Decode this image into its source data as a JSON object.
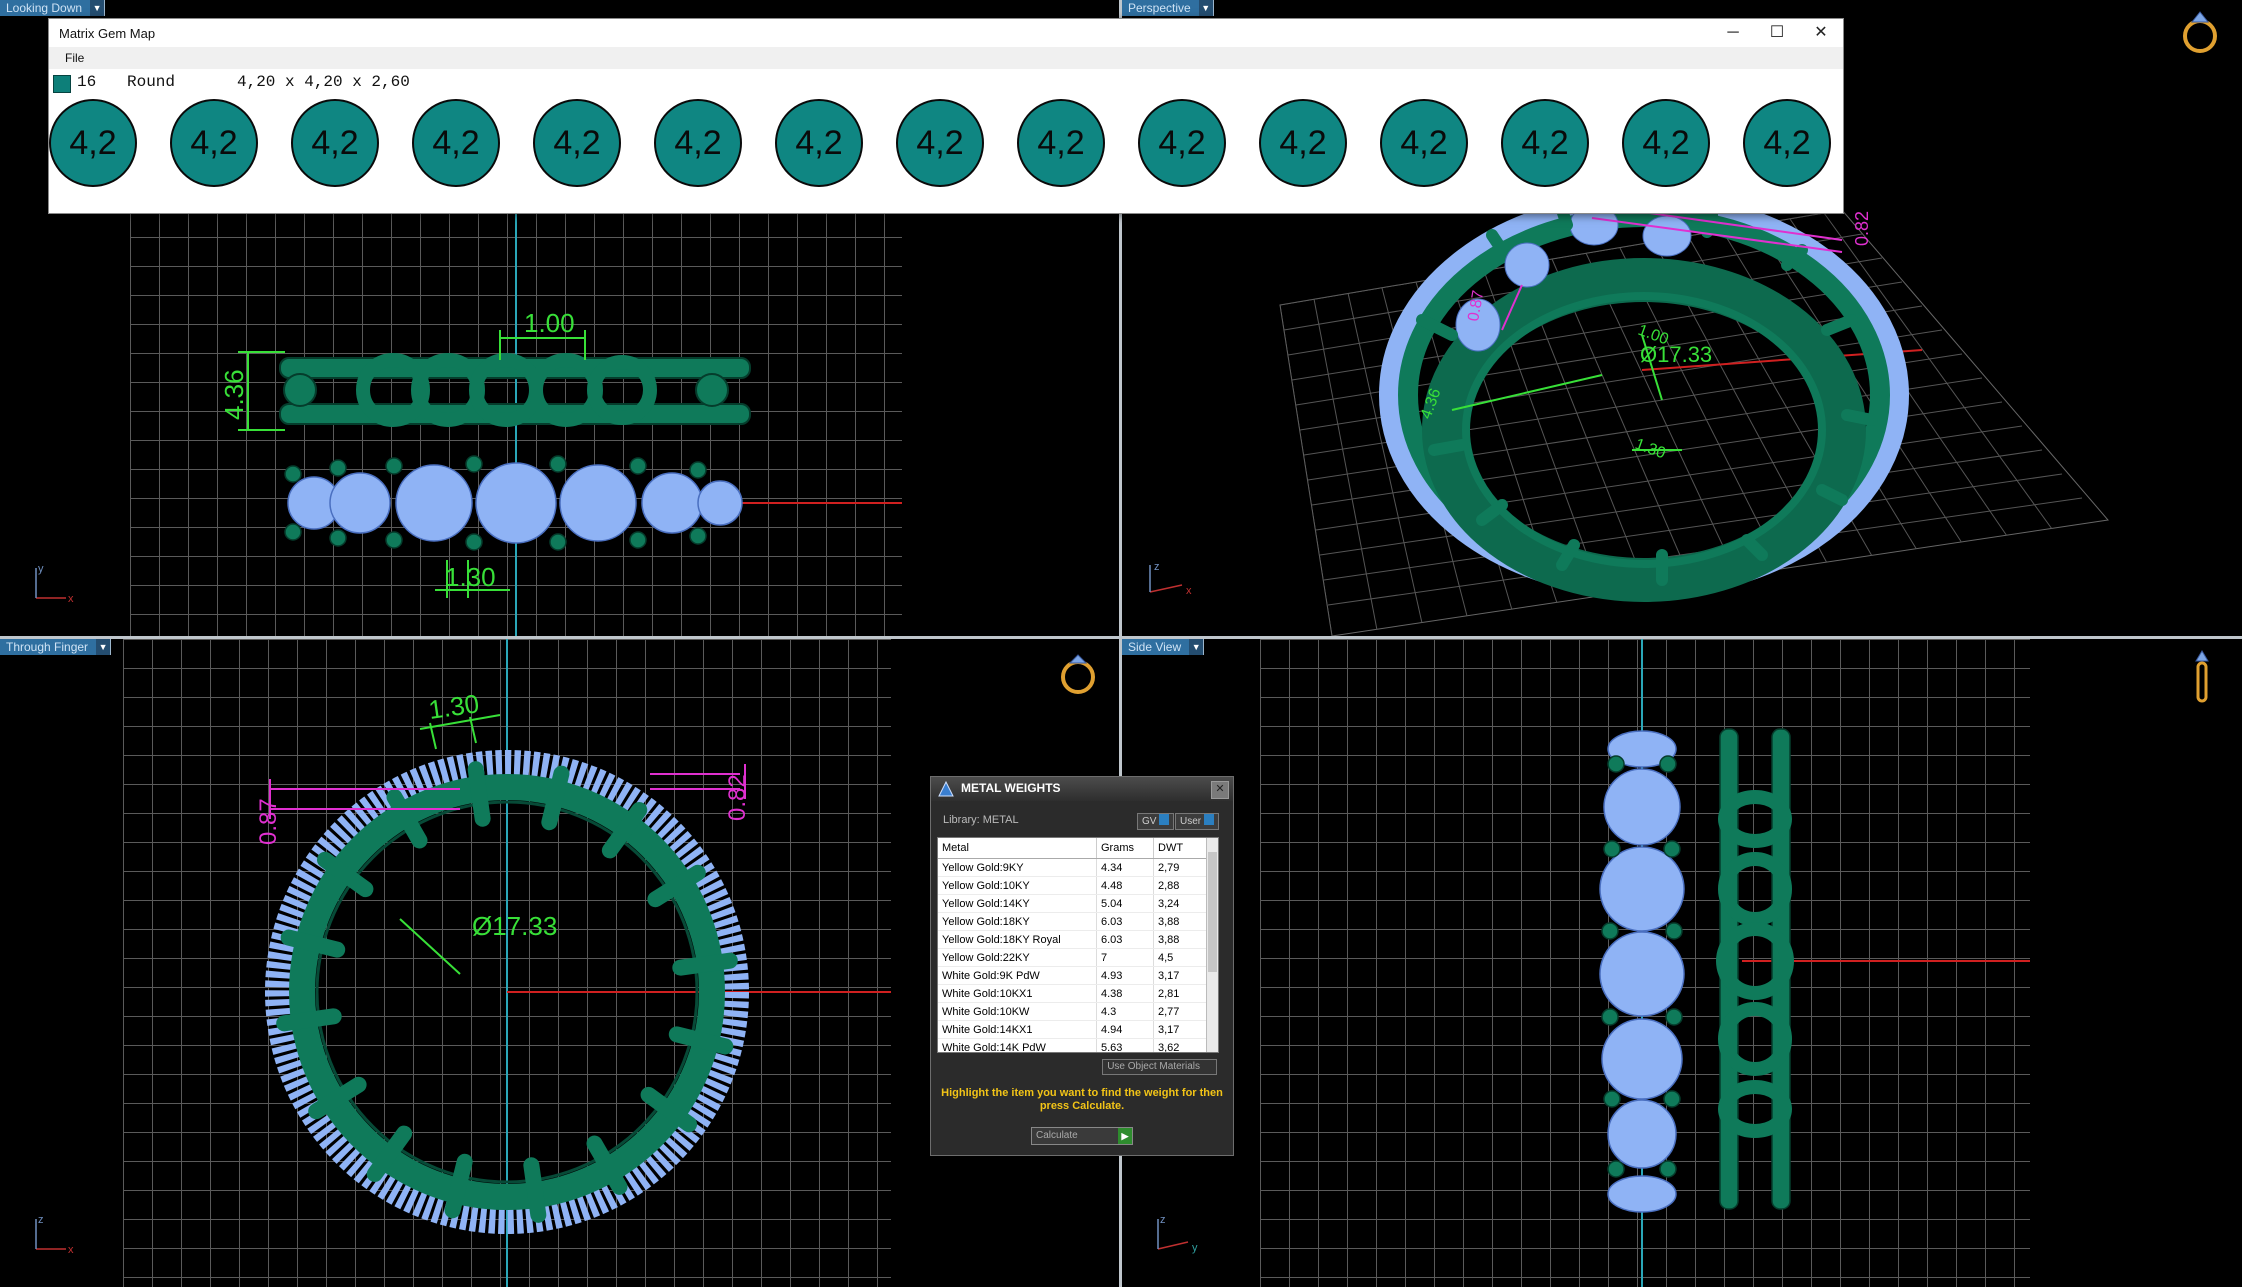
{
  "viewports": {
    "top_left": {
      "label": "Looking Down"
    },
    "top_right": {
      "label": "Perspective"
    },
    "bottom_left": {
      "label": "Through Finger"
    },
    "bottom_right": {
      "label": "Side View"
    }
  },
  "dimensions": {
    "top_left": {
      "width_top": "1.00",
      "height_left": "4.36",
      "gap_bottom": "1.30"
    },
    "top_right": {
      "diameter": "Ø17.33",
      "small_a": "1.00",
      "small_b": "1.30",
      "side_a": "4.36",
      "side_b": "0.87",
      "top_right_val": "0.82"
    },
    "bottom_left": {
      "top": "1.30",
      "left": "0.87",
      "right": "0.82",
      "diameter": "Ø17.33"
    }
  },
  "axes": {
    "top_left": {
      "v": "y",
      "h": "x"
    },
    "top_right": {
      "v": "z",
      "h": "x"
    },
    "bottom_left": {
      "v": "z",
      "h": "x"
    },
    "bottom_right": {
      "v": "z",
      "h": "y"
    }
  },
  "gem_window": {
    "title": "Matrix Gem Map",
    "menu": "File",
    "count": "16",
    "shape": "Round",
    "size": "4,20 x 4,20 x 2,60",
    "swatch_color": "#0d7f79",
    "gem_labels": [
      "4,2",
      "4,2",
      "4,2",
      "4,2",
      "4,2",
      "4,2",
      "4,2",
      "4,2",
      "4,2",
      "4,2",
      "4,2",
      "4,2",
      "4,2",
      "4,2",
      "4,2"
    ],
    "controls": {
      "minimize": "─",
      "maximize": "☐",
      "close": "✕"
    }
  },
  "metal_weights": {
    "title": "METAL WEIGHTS",
    "library": "Library: METAL",
    "btn_gv": "GV",
    "btn_user": "User",
    "columns": [
      "Metal",
      "Grams",
      "DWT"
    ],
    "rows": [
      [
        "Yellow Gold:9KY",
        "4.34",
        "2,79"
      ],
      [
        "Yellow Gold:10KY",
        "4.48",
        "2,88"
      ],
      [
        "Yellow Gold:14KY",
        "5.04",
        "3,24"
      ],
      [
        "Yellow Gold:18KY",
        "6.03",
        "3,88"
      ],
      [
        "Yellow Gold:18KY Royal",
        "6.03",
        "3,88"
      ],
      [
        "Yellow Gold:22KY",
        "7",
        "4,5"
      ],
      [
        "White Gold:9K PdW",
        "4.93",
        "3,17"
      ],
      [
        "White Gold:10KX1",
        "4.38",
        "2,81"
      ],
      [
        "White Gold:10KW",
        "4.3",
        "2,77"
      ],
      [
        "White Gold:14KX1",
        "4.94",
        "3,17"
      ],
      [
        "White Gold:14K PdW",
        "5.63",
        "3,62"
      ]
    ],
    "use_object_materials": "Use Object Materials",
    "message": "Highlight the item you want to find the weight for then press Calculate.",
    "calculate": "Calculate",
    "close": "✕"
  },
  "colors": {
    "metal": "#0f7a5a",
    "gem": "#8fb3f5",
    "dimension_green": "#38e038",
    "dimension_magenta": "#e030d0",
    "grid": "#5a5a5a"
  }
}
